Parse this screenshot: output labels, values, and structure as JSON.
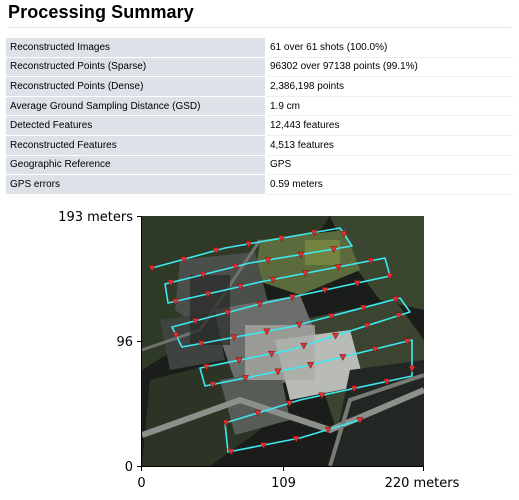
{
  "header": {
    "title": "Processing Summary"
  },
  "summary": {
    "rows": [
      {
        "label": "Reconstructed Images",
        "value": "61 over 61 shots (100.0%)"
      },
      {
        "label": "Reconstructed Points (Sparse)",
        "value": "96302 over 97138 points (99.1%)"
      },
      {
        "label": "Reconstructed Points (Dense)",
        "value": "2,386,198 points"
      },
      {
        "label": "Average Ground Sampling Distance (GSD)",
        "value": "1.9 cm"
      },
      {
        "label": "Detected Features",
        "value": "12,443 features"
      },
      {
        "label": "Reconstructed Features",
        "value": "4,513 features"
      },
      {
        "label": "Geographic Reference",
        "value": "GPS"
      },
      {
        "label": "GPS errors",
        "value": "0.59 meters"
      }
    ]
  },
  "map": {
    "x_ticks": [
      "0",
      "109",
      "220 meters"
    ],
    "y_ticks": [
      "193 meters",
      "96",
      "0"
    ],
    "flight_path_color": "#3ee8f0",
    "camera_marker_color": "#e03030"
  }
}
